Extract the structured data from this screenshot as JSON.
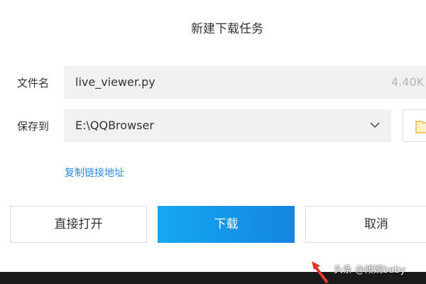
{
  "dialog": {
    "title": "新建下载任务"
  },
  "filename": {
    "label": "文件名",
    "value": "live_viewer.py",
    "size": "4.40K"
  },
  "save_to": {
    "label": "保存到",
    "value": "E:\\QQBrowser"
  },
  "icons": {
    "dropdown": "chevron-down-icon",
    "folder": "folder-icon",
    "annotation": "red-arrow-icon"
  },
  "copy_link": {
    "label": "复制链接地址"
  },
  "buttons": {
    "open": "直接打开",
    "download": "下载",
    "cancel": "取消"
  },
  "watermark": {
    "text": "头条 @倾嫣baby"
  },
  "colors": {
    "accent": "#1596e8",
    "link": "#2a8cde",
    "arrow": "#e03a2f"
  }
}
